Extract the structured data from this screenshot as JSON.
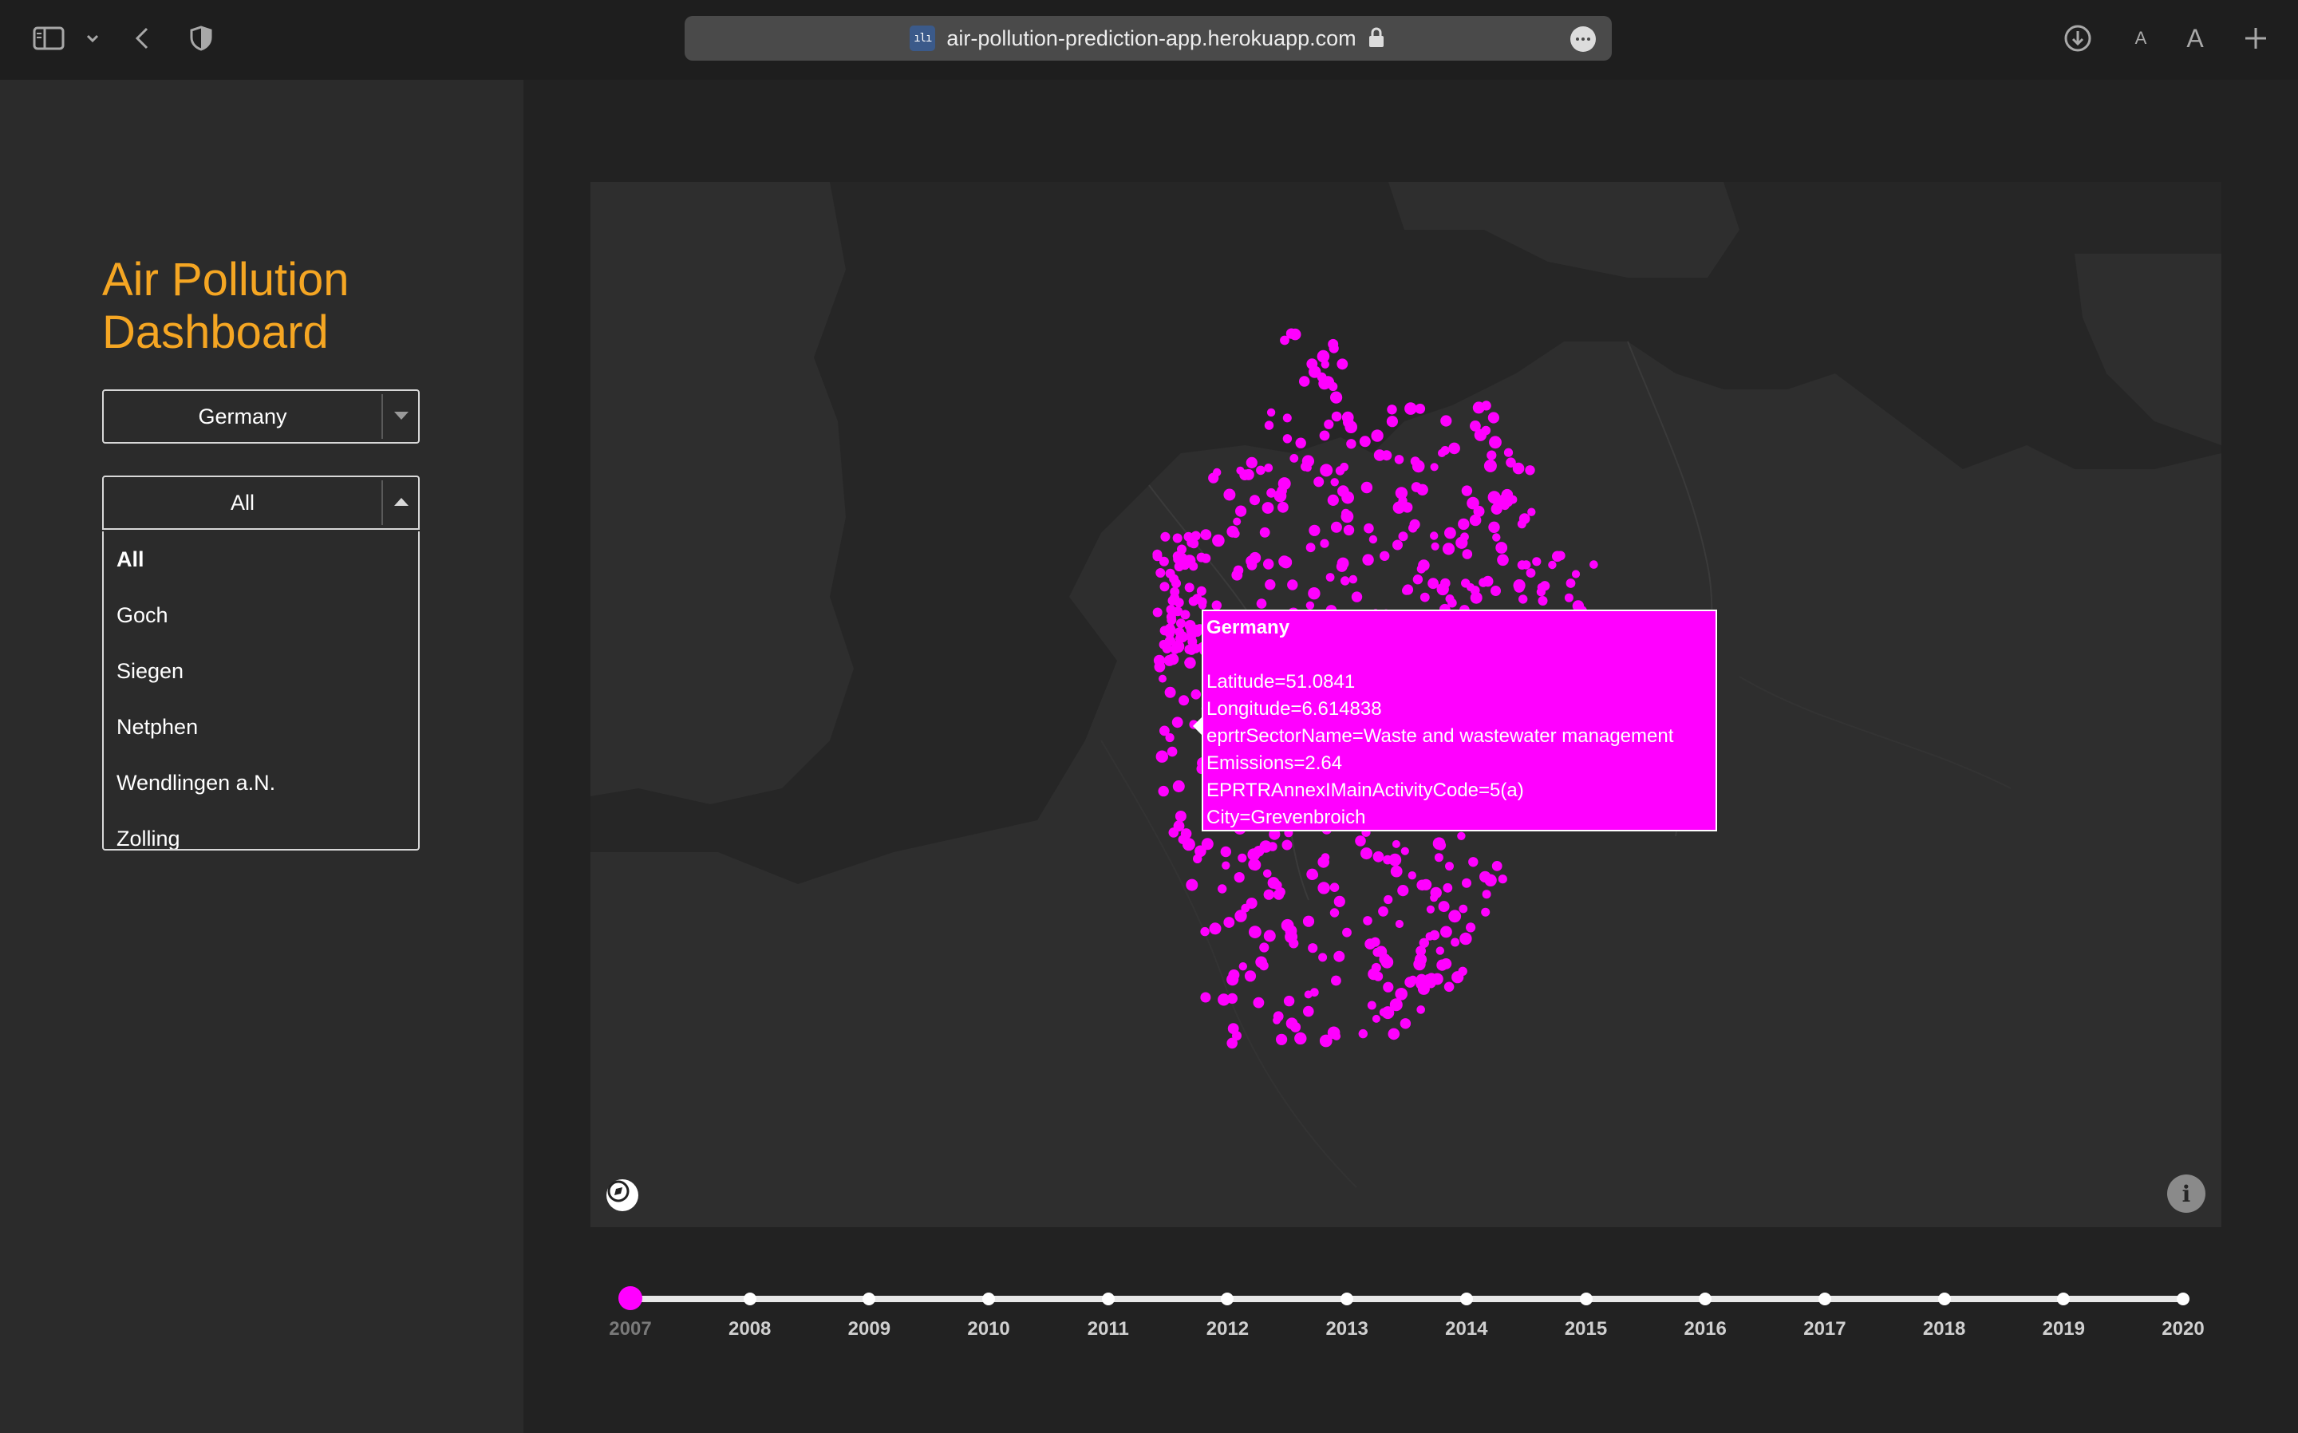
{
  "browser": {
    "url": "air-pollution-prediction-app.herokuapp.com",
    "icons": [
      "sidebar-toggle-icon",
      "chevron-down-icon",
      "back-icon",
      "shield-icon",
      "favicon",
      "lock-icon",
      "more-icon",
      "download-icon",
      "text-smaller-icon",
      "text-larger-icon",
      "new-tab-icon"
    ],
    "text_small_label": "A",
    "text_large_label": "A"
  },
  "sidebar": {
    "title_line1": "Air Pollution",
    "title_line2": "Dashboard",
    "title_color": "#f5a623",
    "country_select": {
      "value": "Germany"
    },
    "city_select": {
      "value": "All",
      "options": [
        "All",
        "Goch",
        "Siegen",
        "Netphen",
        "Wendlingen a.N.",
        "Zolling"
      ]
    }
  },
  "map": {
    "marker_color": "#ff00ff",
    "tooltip": {
      "title": "Germany",
      "lines": [
        "Latitude=51.0841",
        "Longitude=6.614838",
        "eprtrSectorName=Waste and wastewater management",
        "Emissions=2.64",
        "EPRTRAnnexIMainActivityCode=5(a)",
        "City=Grevenbroich"
      ]
    },
    "info_label": "i"
  },
  "timeline": {
    "years": [
      "2007",
      "2008",
      "2009",
      "2010",
      "2011",
      "2012",
      "2013",
      "2014",
      "2015",
      "2016",
      "2017",
      "2018",
      "2019",
      "2020"
    ],
    "selected": "2007",
    "handle_color": "#ff00ff"
  }
}
